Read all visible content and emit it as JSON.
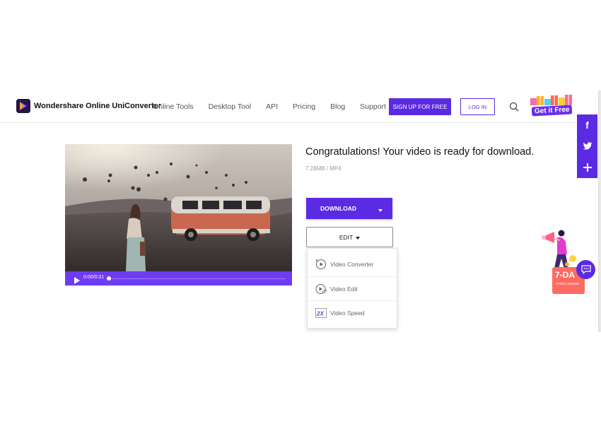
{
  "brand": {
    "name": "Wondershare Online UniConverter",
    "accent": "#5b2be3"
  },
  "nav": {
    "items": [
      {
        "label": "Online Tools"
      },
      {
        "label": "Desktop Tool"
      },
      {
        "label": "API"
      },
      {
        "label": "Pricing"
      },
      {
        "label": "Blog"
      },
      {
        "label": "Support"
      }
    ],
    "signup_label": "SIGN UP FOR FREE",
    "login_label": "LOG IN",
    "search_icon": "search-icon",
    "gift_label": "Get it Free"
  },
  "social": {
    "icons": [
      "facebook-icon",
      "twitter-icon",
      "plus-icon"
    ],
    "facebook": "f"
  },
  "video": {
    "time": "0:00/0:31",
    "progress": 0.0
  },
  "result": {
    "title": "Congratulations! Your video is ready for download.",
    "meta": "7.28MB / MP4",
    "download_label": "DOWNLOAD",
    "edit_label": "EDIT",
    "menu": [
      {
        "label": "Video Converter",
        "icon": "video-converter-icon"
      },
      {
        "label": "Video Edit",
        "icon": "video-edit-icon"
      },
      {
        "label": "Video Speed",
        "icon": "video-speed-icon",
        "badge": "2X"
      }
    ]
  },
  "promo": {
    "title": "7-DA",
    "subtitle": "FREE LICENSE",
    "color": "#fd6b63"
  },
  "chat": {
    "icon": "chat-icon"
  }
}
